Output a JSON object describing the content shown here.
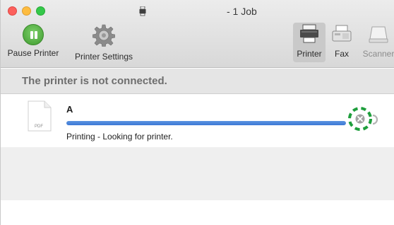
{
  "window": {
    "title": "- 1 Job"
  },
  "toolbar": {
    "pause_label": "Pause Printer",
    "settings_label": "Printer Settings",
    "segments": {
      "printer": "Printer",
      "fax": "Fax",
      "scanner": "Scanner"
    }
  },
  "status": {
    "message": "The printer is not connected."
  },
  "job": {
    "name": "A",
    "file_type": "PDF",
    "status": "Printing - Looking for printer.",
    "progress": 1.0
  },
  "icons": {
    "title": "printer-icon",
    "pause": "pause-icon",
    "settings": "gear-icon",
    "printer": "printer-icon",
    "fax": "fax-icon",
    "scanner": "scanner-icon",
    "document": "pdf-document-icon",
    "cancel": "cancel-icon",
    "resume": "resume-icon"
  },
  "colors": {
    "pause_green": "#4caf3a",
    "progress_blue": "#3d79d6",
    "highlight_green": "#1e9e3c"
  }
}
